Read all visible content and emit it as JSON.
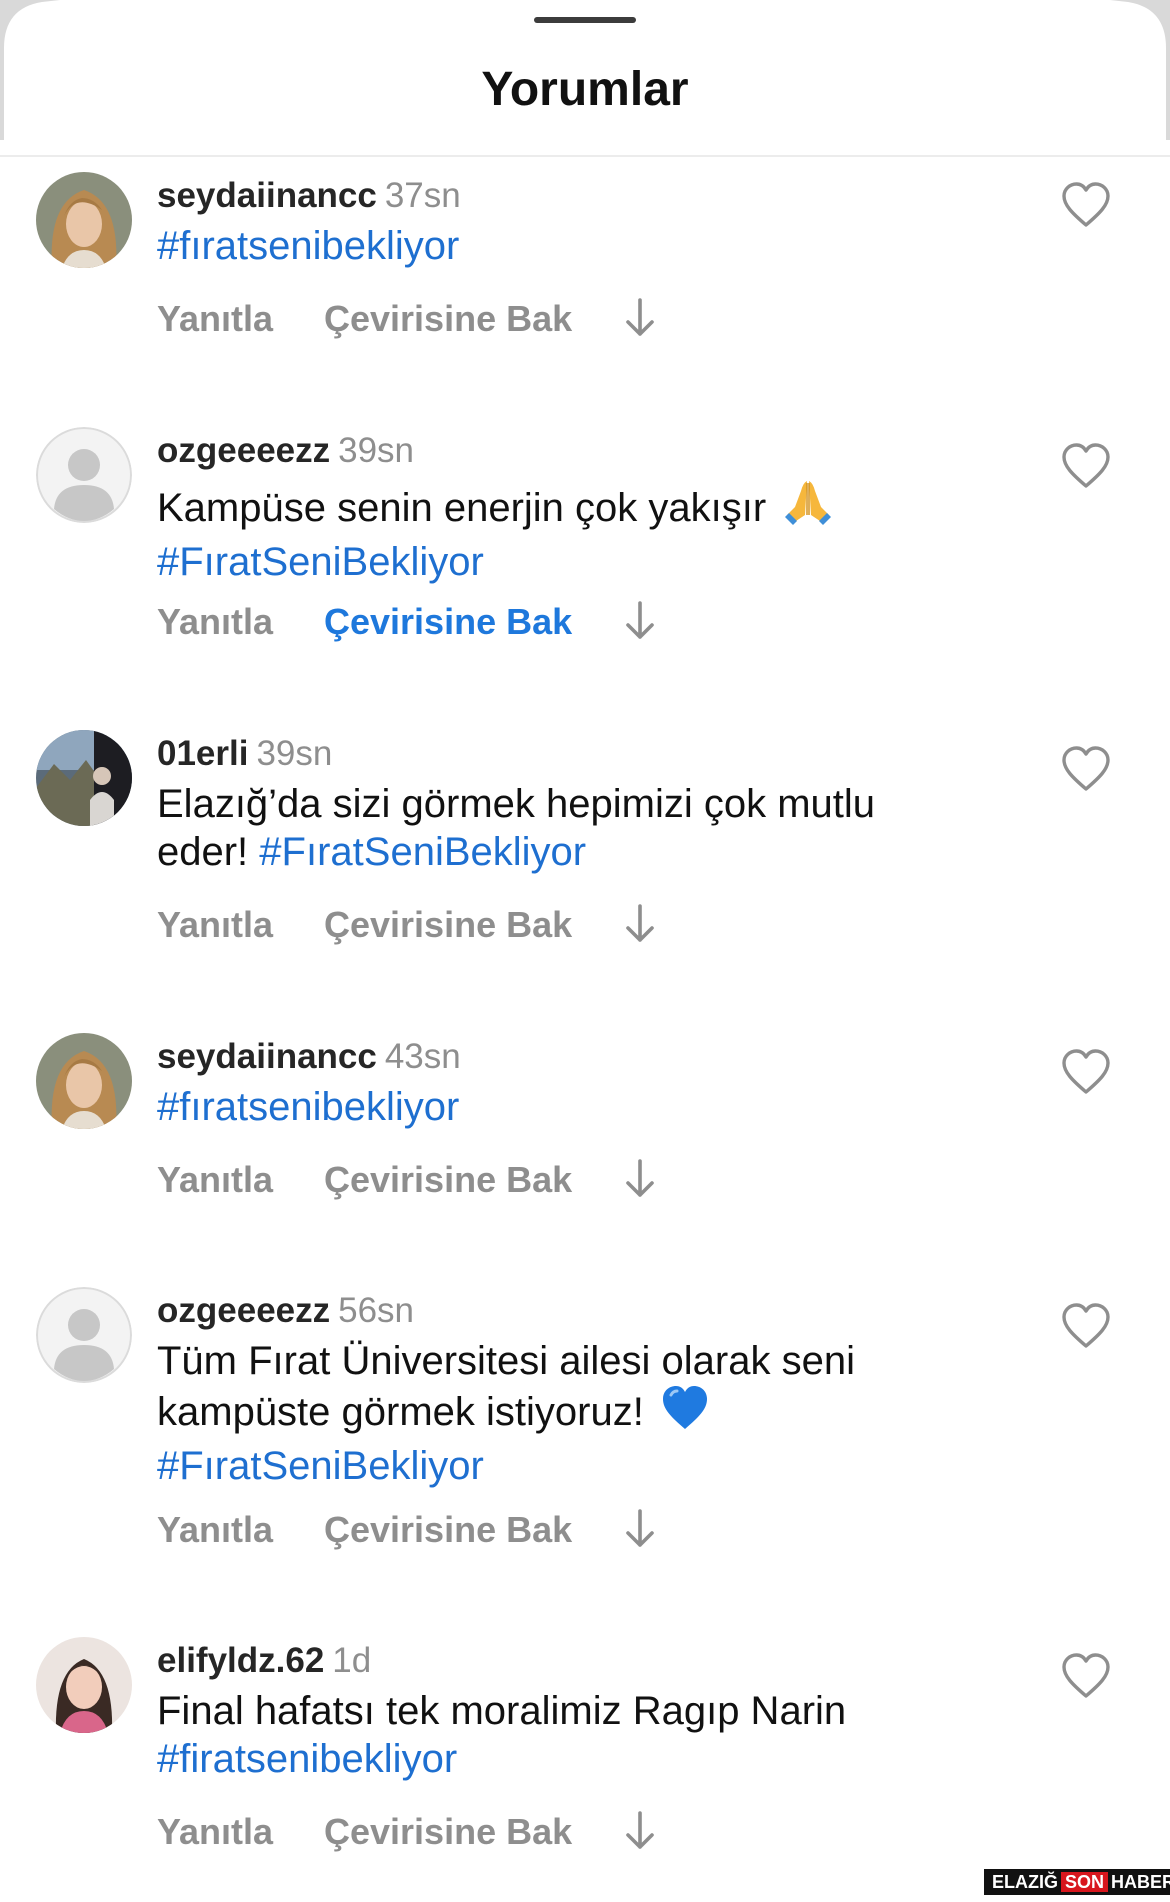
{
  "header": {
    "title": "Yorumlar"
  },
  "labels": {
    "reply": "Yanıtla",
    "translate": "Çevirisine Bak"
  },
  "comments": [
    {
      "username": "seydaiinancc",
      "time": "37sn",
      "text": "",
      "hashtag": "#fıratsenibekliyor",
      "emoji": "",
      "avatar": "woman-blonde",
      "translate_highlighted": false
    },
    {
      "username": "ozgeeeezz",
      "time": "39sn",
      "text": "Kampüse senin enerjin çok yakışır",
      "hashtag": "#FıratSeniBekliyor",
      "emoji": "praying-hands",
      "avatar": "default-person",
      "translate_highlighted": true
    },
    {
      "username": "01erli",
      "time": "39sn",
      "text": "Elazığ’da sizi görmek hepimizi çok mutlu eder!",
      "hashtag": "#FıratSeniBekliyor",
      "emoji": "",
      "avatar": "landscape-person",
      "translate_highlighted": false
    },
    {
      "username": "seydaiinancc",
      "time": "43sn",
      "text": "",
      "hashtag": "#fıratsenibekliyor",
      "emoji": "",
      "avatar": "woman-blonde",
      "translate_highlighted": false
    },
    {
      "username": "ozgeeeezz",
      "time": "56sn",
      "text": "Tüm Fırat Üniversitesi ailesi olarak seni kampüste görmek istiyoruz!",
      "hashtag": "#FıratSeniBekliyor",
      "emoji": "blue-heart",
      "avatar": "default-person",
      "translate_highlighted": false
    },
    {
      "username": "elifyldz.62",
      "time": "1d",
      "text": "Final hafatsı tek moralimiz Ragıp Narin",
      "hashtag": "#firatsenibekliyor",
      "emoji": "",
      "avatar": "woman-dark-hair",
      "translate_highlighted": false
    }
  ],
  "watermark": {
    "part1": "ELAZIĞ",
    "part2": "SON",
    "part3": "HABER"
  },
  "colors": {
    "hashtag": "#1e6fd0",
    "translate_active": "#1e78dc",
    "muted": "#8e8e8e",
    "username": "#262626"
  }
}
